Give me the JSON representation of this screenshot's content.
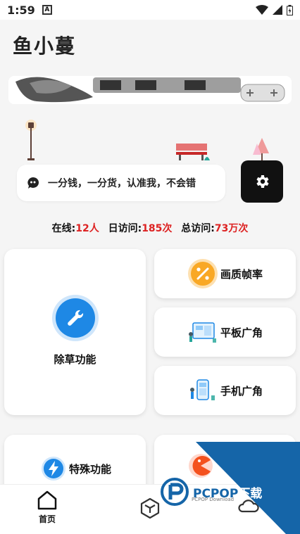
{
  "status_bar": {
    "time": "1:59",
    "notif_letter": "A"
  },
  "app": {
    "title": "鱼小蔓"
  },
  "quote": {
    "text": "一分钱，一分货，认准我，不会错"
  },
  "stats": {
    "online_label": "在线:",
    "online_value": "12人",
    "daily_label": "日访问:",
    "daily_value": "185次",
    "total_label": "总访问:",
    "total_value": "73万次"
  },
  "features": {
    "main": "除草功能",
    "picture_quality": "画质帧率",
    "tablet_wide": "平板广角",
    "phone_wide": "手机广角",
    "special": "特殊功能"
  },
  "tabbar": {
    "home": "首页"
  },
  "watermark": {
    "brand_a": "PCPOP",
    "brand_b": "下载",
    "sub": "PCPOP Download"
  },
  "colors": {
    "accent_red": "#dd2222",
    "blue": "#1e88e5",
    "watermark_blue": "#1565a8"
  }
}
